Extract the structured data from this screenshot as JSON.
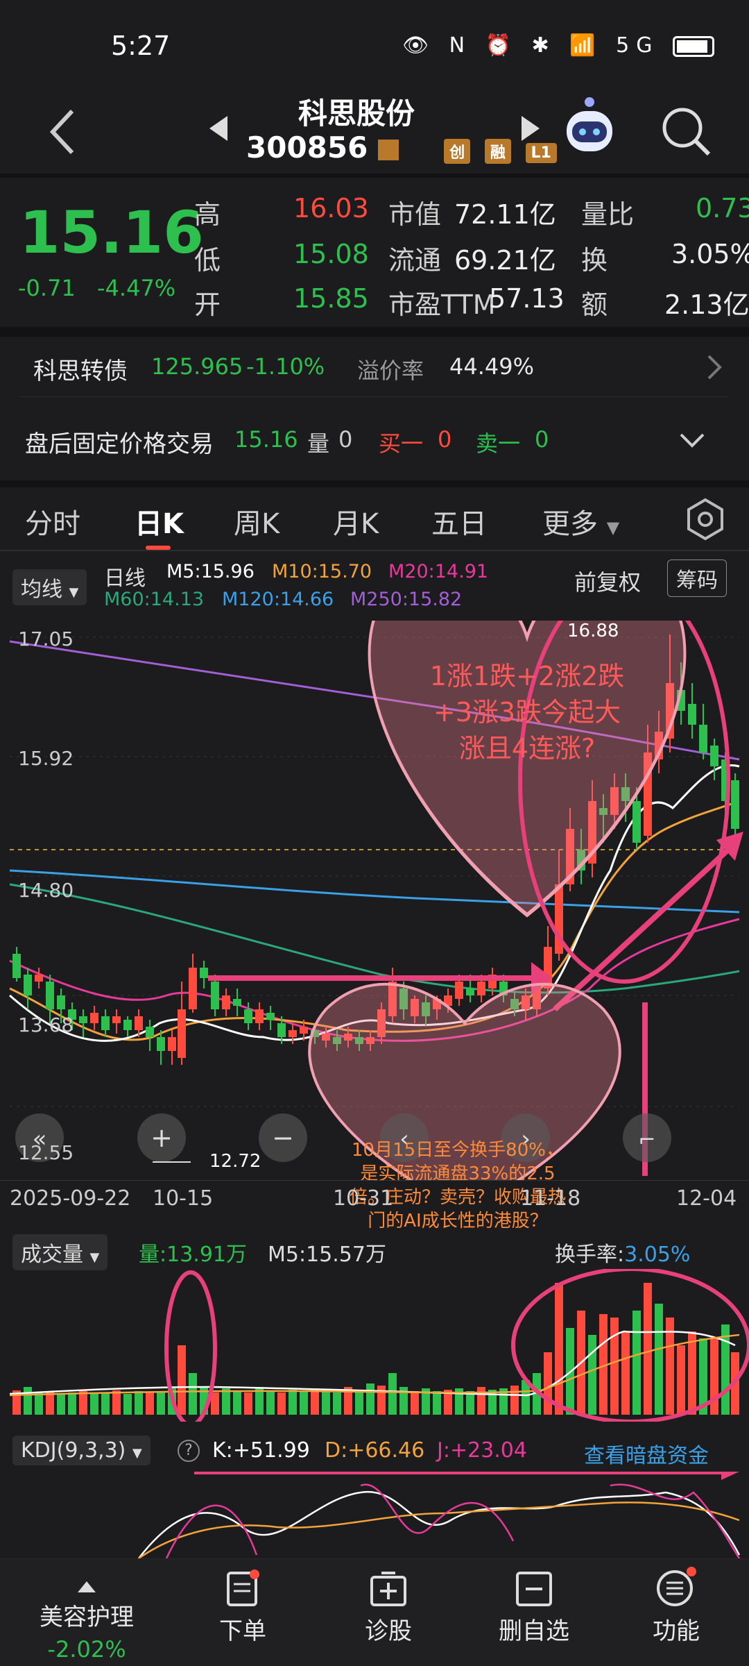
{
  "status_bar": {
    "time": "5:27",
    "icons": "👁 N ⏰ ✱ 📶 5G"
  },
  "header": {
    "name": "科思股份",
    "code": "300856",
    "tags": [
      "创",
      "融",
      "L1"
    ]
  },
  "quote": {
    "price": "15.16",
    "change": "-0.71",
    "change_pct": "-4.47%",
    "rows": [
      {
        "l1": "高",
        "v1": "16.03",
        "l2": "市值",
        "v2": "72.11亿",
        "l3": "量比",
        "v3": "0.73"
      },
      {
        "l1": "低",
        "v1": "15.08",
        "l2": "流通",
        "v2": "69.21亿",
        "l3": "换",
        "v3": "3.05%"
      },
      {
        "l1": "开",
        "v1": "15.85",
        "l2": "市盈TTM",
        "v2": "57.13",
        "l3": "额",
        "v3": "2.13亿"
      }
    ]
  },
  "bond": {
    "name": "科思转债",
    "price": "125.965",
    "pct": "-1.10%",
    "premium_label": "溢价率",
    "premium": "44.49%"
  },
  "after_hours": {
    "label": "盘后固定价格交易",
    "price": "15.16",
    "vol_label": "量",
    "vol": "0",
    "buy_label": "买一",
    "buy": "0",
    "sell_label": "卖一",
    "sell": "0"
  },
  "tabs": [
    "分时",
    "日K",
    "周K",
    "月K",
    "五日",
    "更多"
  ],
  "chart_header": {
    "ma_select": "均线",
    "period": "日线",
    "m5": "M5:15.96",
    "m10": "M10:15.70",
    "m20": "M20:14.91",
    "m60": "M60:14.13",
    "m120": "M120:14.66",
    "m250": "M250:15.82",
    "adjust": "前复权",
    "chips": "筹码"
  },
  "chart_labels": {
    "y1": "17.05",
    "y2": "15.92",
    "y3": "14.80",
    "y4": "13.68",
    "y5": "12.55",
    "high": "16.88",
    "low": "12.72",
    "d1": "2025-09-22",
    "d2": "10-15",
    "d3": "10-31",
    "d4": "11-18",
    "d5": "12-04"
  },
  "annotations": {
    "heart1": "1涨1跌+2涨2跌+3涨3跌今起大涨且4连涨?",
    "heart2": "10月15日至今换手80%，是实际流通盘33%的2.5倍。庄动？卖壳？收购最热门的AI成长性的港股？"
  },
  "volume": {
    "select": "成交量",
    "vol": "量:13.91万",
    "m5": "M5:15.57万",
    "turnover_label": "换手率:",
    "turnover": "3.05%"
  },
  "kdj": {
    "select": "KDJ(9,3,3)",
    "k": "K:+51.99",
    "d": "D:+66.46",
    "j": "J:+23.04",
    "link": "查看暗盘资金"
  },
  "bottom": [
    {
      "label": "美容护理",
      "sub": "-2.02%"
    },
    {
      "label": "下单"
    },
    {
      "label": "诊股"
    },
    {
      "label": "删自选"
    },
    {
      "label": "功能"
    }
  ],
  "colors": {
    "up": "#ff4b3e",
    "down": "#2ec04f",
    "annot": "#e8407a"
  }
}
